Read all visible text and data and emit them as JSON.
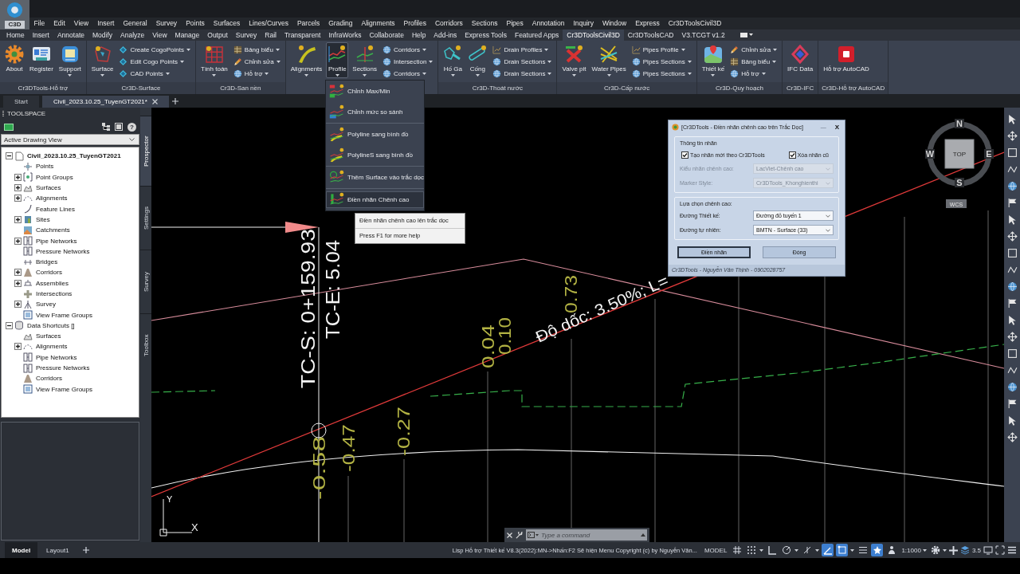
{
  "app_button": {
    "label": "C3D"
  },
  "menu_bar": [
    "File",
    "Edit",
    "View",
    "Insert",
    "General",
    "Survey",
    "Points",
    "Surfaces",
    "Lines/Curves",
    "Parcels",
    "Grading",
    "Alignments",
    "Profiles",
    "Corridors",
    "Sections",
    "Pipes",
    "Annotation",
    "Inquiry",
    "Window",
    "Express",
    "Cr3DToolsCivil3D"
  ],
  "ribbon_tabs": [
    {
      "label": "Home",
      "selected": false
    },
    {
      "label": "Insert",
      "selected": false
    },
    {
      "label": "Annotate",
      "selected": false
    },
    {
      "label": "Modify",
      "selected": false
    },
    {
      "label": "Analyze",
      "selected": false
    },
    {
      "label": "View",
      "selected": false
    },
    {
      "label": "Manage",
      "selected": false
    },
    {
      "label": "Output",
      "selected": false
    },
    {
      "label": "Survey",
      "selected": false
    },
    {
      "label": "Rail",
      "selected": false
    },
    {
      "label": "Transparent",
      "selected": false
    },
    {
      "label": "InfraWorks",
      "selected": false
    },
    {
      "label": "Collaborate",
      "selected": false
    },
    {
      "label": "Help",
      "selected": false
    },
    {
      "label": "Add-ins",
      "selected": false
    },
    {
      "label": "Express Tools",
      "selected": false
    },
    {
      "label": "Featured Apps",
      "selected": false
    },
    {
      "label": "Cr3DToolsCivil3D",
      "selected": true
    },
    {
      "label": "Cr3DToolsCAD",
      "selected": false
    },
    {
      "label": "V3.TCGT v1.2",
      "selected": false
    }
  ],
  "ribbon_panels": [
    {
      "title": "Cr3DTools-Hỗ trợ",
      "large_buttons": [
        {
          "label": "About",
          "dropdown": false,
          "selected": false
        },
        {
          "label": "Register",
          "dropdown": false,
          "selected": false
        },
        {
          "label": "Support",
          "dropdown": true,
          "selected": false
        }
      ]
    },
    {
      "title": "Cr3D-Surface",
      "large_buttons": [
        {
          "label": "Surface",
          "dropdown": true,
          "selected": false
        }
      ],
      "small_buttons": [
        {
          "label": "Create CogoPoints",
          "dropdown": true
        },
        {
          "label": "Edit Cogo Points",
          "dropdown": true
        },
        {
          "label": "CAD Points",
          "dropdown": true
        }
      ]
    },
    {
      "title": "Cr3D-San nền",
      "large_buttons": [
        {
          "label": "Tính toán",
          "dropdown": true,
          "selected": false
        }
      ],
      "small_buttons": [
        {
          "label": "Bảng biểu",
          "dropdown": true
        },
        {
          "label": "Chỉnh sửa",
          "dropdown": true
        },
        {
          "label": "Hỗ trợ",
          "dropdown": true
        }
      ]
    },
    {
      "large_buttons": [
        {
          "label": "Alignments",
          "dropdown": true,
          "selected": false
        },
        {
          "label": "Profile",
          "dropdown": true,
          "selected": true
        },
        {
          "label": "Sections",
          "dropdown": true,
          "selected": false
        }
      ],
      "small_buttons": [
        {
          "label": "Corridors",
          "dropdown": true
        },
        {
          "label": "Intersection",
          "dropdown": true
        },
        {
          "label": "Corridors",
          "dropdown": true
        }
      ]
    },
    {
      "title": "Cr3D-Thoát nước",
      "large_buttons": [
        {
          "label": "Hố Ga",
          "dropdown": true,
          "selected": false
        },
        {
          "label": "Cống",
          "dropdown": true,
          "selected": false
        }
      ],
      "small_buttons": [
        {
          "label": "Drain Profiles",
          "dropdown": true
        },
        {
          "label": "Drain Sections",
          "dropdown": true
        },
        {
          "label": "Drain Sections",
          "dropdown": true
        }
      ]
    },
    {
      "title": "Cr3D-Cấp nước",
      "large_buttons": [
        {
          "label": "Valve pit",
          "dropdown": true,
          "selected": false
        },
        {
          "label": "Water Pipes",
          "dropdown": true,
          "selected": false
        }
      ],
      "small_buttons": [
        {
          "label": "Pipes Profile",
          "dropdown": true
        },
        {
          "label": "Pipes Sections",
          "dropdown": true
        },
        {
          "label": "Pipes Sections",
          "dropdown": true
        }
      ]
    },
    {
      "title": "Cr3D-Quy hoạch",
      "large_buttons": [
        {
          "label": "Thiết kế",
          "dropdown": true,
          "selected": false
        }
      ],
      "small_buttons": [
        {
          "label": "Chỉnh sửa",
          "dropdown": true
        },
        {
          "label": "Bảng biểu",
          "dropdown": true
        },
        {
          "label": "Hỗ trợ",
          "dropdown": true
        }
      ]
    },
    {
      "title": "Cr3D-IFC",
      "large_buttons": [
        {
          "label": "IFC Data",
          "dropdown": false,
          "selected": false
        }
      ]
    },
    {
      "title": "Cr3D-Hỗ trợ AutoCAD",
      "large_buttons": [
        {
          "label": "Hỗ trợ AutoCAD",
          "dropdown": false,
          "selected": false
        }
      ]
    }
  ],
  "document_tabs": [
    {
      "label": "Start",
      "selected": false,
      "closable": false
    },
    {
      "label": "Civil_2023.10.25_TuyenGT2021*",
      "selected": true,
      "closable": true
    }
  ],
  "toolspace": {
    "title": "TOOLSPACE",
    "help": "?",
    "view": "Active Drawing View",
    "tree": [
      {
        "label": "Civil_2023.10.25_TuyenGT2021",
        "current": true,
        "expanded": true,
        "children": [
          {
            "label": "Points"
          },
          {
            "label": "Point Groups",
            "expanded": false
          },
          {
            "label": "Surfaces",
            "expanded": false
          },
          {
            "label": "Alignments",
            "expanded": false
          },
          {
            "label": "Feature Lines"
          },
          {
            "label": "Sites",
            "expanded": false
          },
          {
            "label": "Catchments"
          },
          {
            "label": "Pipe Networks",
            "expanded": false
          },
          {
            "label": "Pressure Networks"
          },
          {
            "label": "Bridges"
          },
          {
            "label": "Corridors",
            "expanded": false
          },
          {
            "label": "Assemblies",
            "expanded": false
          },
          {
            "label": "Intersections"
          },
          {
            "label": "Survey",
            "expanded": false
          },
          {
            "label": "View Frame Groups"
          }
        ]
      },
      {
        "label": "Data Shortcuts []",
        "current": false,
        "expanded": true,
        "children": [
          {
            "label": "Surfaces"
          },
          {
            "label": "Alignments",
            "expanded": false
          },
          {
            "label": "Pipe Networks"
          },
          {
            "label": "Pressure Networks"
          },
          {
            "label": "Corridors"
          },
          {
            "label": "View Frame Groups"
          }
        ]
      }
    ],
    "side_tabs": [
      {
        "label": "Prospector",
        "selected": true
      },
      {
        "label": "Settings",
        "selected": false
      },
      {
        "label": "Survey",
        "selected": false
      },
      {
        "label": "Toolbox",
        "selected": false
      }
    ]
  },
  "profile_menu": {
    "groups": [
      {
        "items": [
          {
            "label": "Chỉnh Max/Min",
            "selected": false
          },
          {
            "label": "Chỉnh mức so sánh",
            "selected": false
          }
        ]
      },
      {
        "items": [
          {
            "label": "Polyline sang bình đồ",
            "selected": false
          },
          {
            "label": "PolylineS sang bình đồ",
            "selected": false
          }
        ]
      },
      {
        "items": [
          {
            "label": "Thêm Surface vào trắc dọc",
            "selected": false
          }
        ]
      },
      {
        "items": [
          {
            "label": "Điền nhãn Chênh cao",
            "selected": true
          }
        ]
      }
    ]
  },
  "tooltip": {
    "text": "Điền nhãn chênh cao lên trắc dọc",
    "help": "Press F1 for more help"
  },
  "drawing": {
    "station_labels": [
      "TC-S: 0+159.93",
      "TC-E: 5.04"
    ],
    "grade_label": "Độ dốc: 3.50%; L=",
    "elevation_labels": [
      "0.04",
      "0.10",
      "0.73",
      "-0.58",
      "-0.47",
      "-0.27"
    ],
    "axis_labels": [
      "Y",
      "X"
    ]
  },
  "viewcube": {
    "north": "N",
    "south": "S",
    "east": "E",
    "west": "W",
    "face": "TOP",
    "ucs": "WCS"
  },
  "dialog": {
    "title": "[Cr3DTools - Điền nhãn chênh cao trên Trắc Dọc]",
    "minimize": "—",
    "close": "X",
    "groups": [
      {
        "title": "Thông tin nhãn",
        "checkboxes": [
          {
            "label": "Tạo nhãn mới theo Cr3DTools",
            "checked": true
          },
          {
            "label": "Xóa nhãn cũ",
            "checked": true
          }
        ],
        "fields": [
          {
            "label": "Kiểu nhãn chênh cao:",
            "value": "LacViet-Chênh cao",
            "disabled": true
          },
          {
            "label": "Marker Style:",
            "value": "Cr3DTools_Khonghienthi",
            "disabled": true
          }
        ]
      },
      {
        "title": "Lựa chọn chênh cao:",
        "fields": [
          {
            "label": "Đường Thiết kế:",
            "value": "Đường đỏ tuyến 1",
            "disabled": false
          },
          {
            "label": "Đường tự nhiên:",
            "value": "BMTN - Surface (33)",
            "disabled": false
          }
        ]
      }
    ],
    "buttons": [
      {
        "label": "Điền nhãn",
        "default": true
      },
      {
        "label": "Đóng",
        "default": false
      }
    ],
    "footer": "Cr3DTools - Nguyễn Văn Thịnh - 0902028757"
  },
  "command_line": {
    "placeholder": "Type a command"
  },
  "status_bar": {
    "layout_tabs": [
      {
        "label": "Model",
        "selected": true
      },
      {
        "label": "Layout1",
        "selected": false
      }
    ],
    "message": "Lisp Hỗ trợ Thiết kế V8.3(2022):MN->Nhấn:F2 Sẽ hiện Menu Copyright (c) by Nguyễn Văn...",
    "space": "MODEL",
    "toggles": [
      {
        "on": false
      },
      {
        "on": false
      },
      {
        "on": false
      },
      {
        "on": false
      },
      {
        "on": false
      },
      {
        "on": true
      },
      {
        "on": true
      },
      {
        "on": false
      },
      {
        "on": true
      },
      {
        "on": false
      }
    ],
    "scale": "1:1000",
    "readout": "3.5"
  }
}
